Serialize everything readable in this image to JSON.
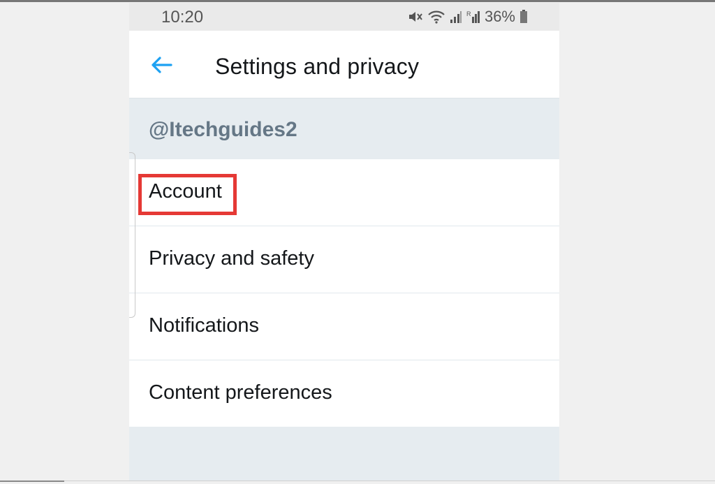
{
  "status_bar": {
    "time": "10:20",
    "battery_percent": "36%",
    "icons": [
      "mute-icon",
      "wifi-icon",
      "signal-icon",
      "roaming-signal-icon",
      "battery-icon"
    ]
  },
  "header": {
    "title": "Settings and privacy",
    "back_icon": "arrow-left-icon",
    "accent_color": "#1da1f2"
  },
  "account": {
    "handle": "@Itechguides2"
  },
  "menu": {
    "items": [
      {
        "label": "Account",
        "highlighted": true
      },
      {
        "label": "Privacy and safety"
      },
      {
        "label": "Notifications"
      },
      {
        "label": "Content preferences"
      }
    ]
  },
  "colors": {
    "highlight": "#e53935",
    "section_background": "#e6ecf0",
    "handle_text": "#657786"
  }
}
